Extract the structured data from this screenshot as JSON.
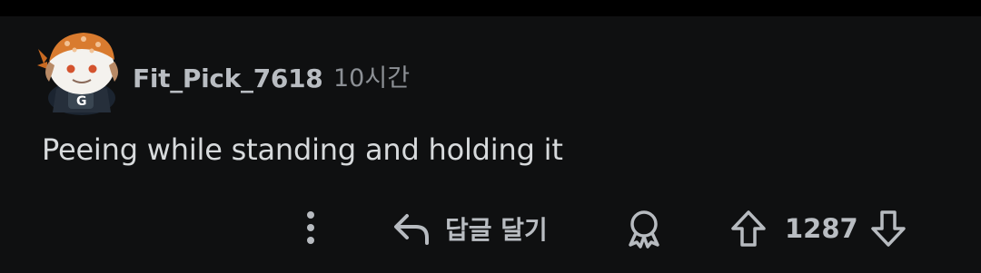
{
  "comment": {
    "username": "Fit_Pick_7618",
    "timestamp": "10시간",
    "body": "Peeing while standing and holding it",
    "avatar_icon": "snoo-avatar-icon"
  },
  "actions": {
    "more_icon": "more-vertical-icon",
    "reply_icon": "reply-arrow-icon",
    "reply_label": "답글 달기",
    "award_icon": "award-icon",
    "upvote_icon": "upvote-arrow-icon",
    "score": "1287",
    "downvote_icon": "downvote-arrow-icon"
  },
  "colors": {
    "background": "#0f1011",
    "text_primary": "#d7dadc",
    "text_secondary": "#8c9095",
    "icon": "#b7bbc0"
  }
}
